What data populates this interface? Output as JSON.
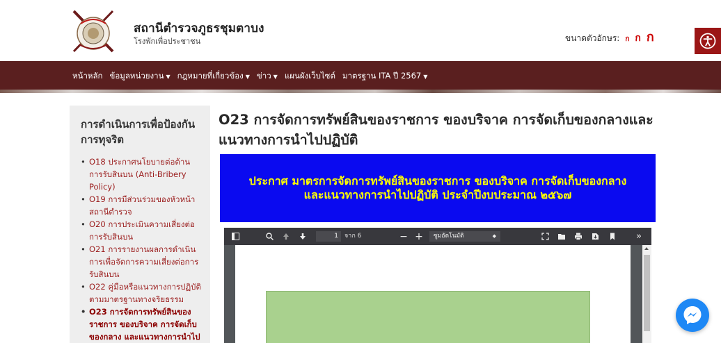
{
  "header": {
    "title": "สถานีตำรวจภูธรชุมตาบง",
    "subtitle": "โรงพักเพื่อประชาชน",
    "font_size_label": "ขนาดตัวอักษร:",
    "font_size_options": [
      "ก",
      "ก",
      "ก"
    ]
  },
  "nav": {
    "items": [
      {
        "label": "หน้าหลัก",
        "has_dropdown": false
      },
      {
        "label": "ข้อมูลหน่วยงาน",
        "has_dropdown": true
      },
      {
        "label": "กฎหมายที่เกี่ยวข้อง",
        "has_dropdown": true
      },
      {
        "label": "ข่าว",
        "has_dropdown": true
      },
      {
        "label": "แผนผังเว็บไซต์",
        "has_dropdown": false
      },
      {
        "label": "มาตรฐาน ITA ปี 2567",
        "has_dropdown": true
      }
    ]
  },
  "sidebar": {
    "title": "การดำเนินการเพื่อป้องกันการทุจริต",
    "items": [
      {
        "label": "O18 ประกาศนโยบายต่อต้านการรับสินบน (Anti-Bribery Policy)",
        "active": false
      },
      {
        "label": "O19 การมีส่วนร่วมของหัวหน้าสถานีตำรวจ",
        "active": false
      },
      {
        "label": "O20 การประเมินความเสี่ยงต่อการรับสินบน",
        "active": false
      },
      {
        "label": "O21 การรายงานผลการดำเนินการเพื่อจัดการความเสี่ยงต่อการรับสินบน",
        "active": false
      },
      {
        "label": "O22 คู่มือหรือแนวทางการปฏิบัติตามมาตรฐานทางจริยธรรม",
        "active": false
      },
      {
        "label": "O23 การจัดการทรัพย์สินของราชการ ของบริจาค การจัดเก็บของกลาง และแนวทางการนำไป",
        "active": true
      }
    ]
  },
  "main": {
    "title": "O23 การจัดการทรัพย์สินของราชการ ของบริจาค การจัดเก็บของกลางและแนวทางการนำไปปฏิบัติ",
    "banner_text": "ประกาศ มาตรการจัดการทรัพย์สินของราชการ ของบริจาค การจัดเก็บของกลาง และแนวทางการนำไปปฏิบัติ ประจำปีงบประมาณ ๒๕๖๗"
  },
  "pdf_viewer": {
    "current_page": "1",
    "page_of": "จาก 6",
    "zoom": "ซูมอัตโนมัติ"
  },
  "colors": {
    "nav_bg": "#5a1f1f",
    "banner_bg": "#0a0af0",
    "banner_text": "#ffff00",
    "accent_red": "#9b1616",
    "messenger_blue": "#1e88f5"
  }
}
